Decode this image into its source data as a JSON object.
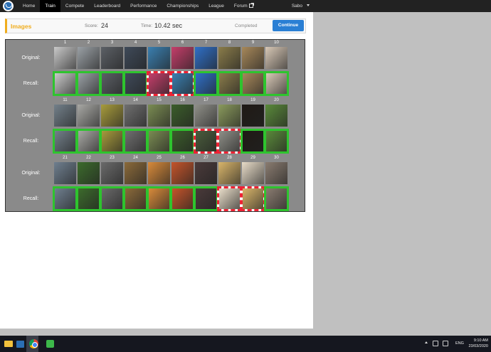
{
  "nav": {
    "items": [
      "Home",
      "Train",
      "Compete",
      "Leaderboard",
      "Performance",
      "Championships",
      "League",
      "Forum"
    ],
    "active": "Train",
    "user": "Sabo"
  },
  "header": {
    "title": "Images",
    "score_label": "Score:",
    "score": "24",
    "time_label": "Time:",
    "time": "10.42 sec",
    "status": "Completed",
    "continue_label": "Continue"
  },
  "grid": {
    "original_label": "Original:",
    "recall_label": "Recall:",
    "blocks": [
      {
        "numbers": [
          "1",
          "2",
          "3",
          "4",
          "5",
          "6",
          "7",
          "8",
          "9",
          "10"
        ],
        "original_colors": [
          "#c9c9c9",
          "#9aa0a5",
          "#5c6066",
          "#3f4a59",
          "#3a7fb0",
          "#c43e6a",
          "#2f6fc7",
          "#8a7c4a",
          "#a7885a",
          "#d8c8b6"
        ],
        "recall_colors": [
          "#c9c9c9",
          "#9aa0a5",
          "#5c6066",
          "#3f4a59",
          "#c43e6a",
          "#3a7fb0",
          "#2f6fc7",
          "#8a7c4a",
          "#a7885a",
          "#d8c8b6"
        ],
        "correct": [
          true,
          true,
          true,
          true,
          false,
          false,
          true,
          true,
          true,
          true
        ]
      },
      {
        "numbers": [
          "11",
          "12",
          "13",
          "14",
          "15",
          "16",
          "17",
          "18",
          "19",
          "20"
        ],
        "original_colors": [
          "#73808a",
          "#a8a8a4",
          "#a79b3c",
          "#6f6f6f",
          "#7a8c52",
          "#3b5d2a",
          "#8f8f88",
          "#8a9a5c",
          "#1f1a15",
          "#5a8a3a"
        ],
        "recall_colors": [
          "#73808a",
          "#a8a8a4",
          "#a79b3c",
          "#6f6f6f",
          "#7a8c52",
          "#3b5d2a",
          "#4a5c3c",
          "#8f8f88",
          "#1f1a15",
          "#5a8a3a"
        ],
        "correct": [
          true,
          true,
          true,
          true,
          true,
          true,
          false,
          false,
          true,
          true
        ]
      },
      {
        "numbers": [
          "21",
          "22",
          "23",
          "24",
          "25",
          "26",
          "27",
          "28",
          "29",
          "30"
        ],
        "original_colors": [
          "#6f7f8f",
          "#3c6b2c",
          "#6a6a6a",
          "#8b6a3a",
          "#d88a3a",
          "#c4542a",
          "#4a3a3a",
          "#d9b56a",
          "#e8dcc8",
          "#8a7c70"
        ],
        "recall_colors": [
          "#6f7f8f",
          "#3c6b2c",
          "#6a6a6a",
          "#8b6a3a",
          "#d88a3a",
          "#c4542a",
          "#4a3a3a",
          "#e8dcc8",
          "#d9b56a",
          "#8a7c70"
        ],
        "correct": [
          true,
          true,
          true,
          true,
          true,
          true,
          true,
          false,
          false,
          true
        ]
      }
    ]
  },
  "taskbar": {
    "lang": "ENG",
    "time": "9:10 AM",
    "date": "23/03/2020"
  }
}
